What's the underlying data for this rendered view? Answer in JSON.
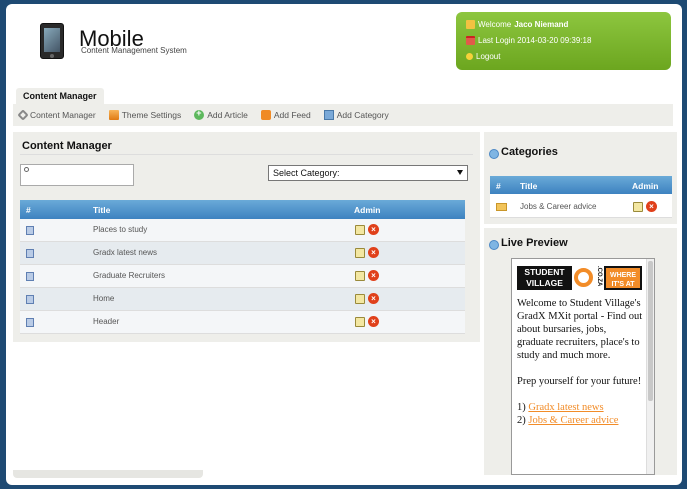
{
  "header": {
    "app_title": "Mobile",
    "app_subtitle": "Content Management System",
    "welcome_label": "Welcome",
    "user_name": "Jaco Niemand",
    "last_login": "Last Login 2014-03-20 09:39:18",
    "logout": "Logout"
  },
  "tabs": [
    {
      "label": "Content Manager"
    }
  ],
  "toolbar": {
    "items": [
      {
        "label": "Content Manager",
        "icon": "wrench-icon"
      },
      {
        "label": "Theme Settings",
        "icon": "theme-icon"
      },
      {
        "label": "Add Article",
        "icon": "add-icon"
      },
      {
        "label": "Add Feed",
        "icon": "rss-icon"
      },
      {
        "label": "Add Category",
        "icon": "category-icon"
      }
    ]
  },
  "content_manager": {
    "title": "Content Manager",
    "search_placeholder": "",
    "category_select": "Select Category:",
    "columns": {
      "num": "#",
      "title": "Title",
      "admin": "Admin"
    },
    "rows": [
      {
        "title": "Places to study"
      },
      {
        "title": "Gradx latest news"
      },
      {
        "title": "Graduate Recruiters"
      },
      {
        "title": "Home"
      },
      {
        "title": "Header"
      }
    ]
  },
  "categories": {
    "title": "Categories",
    "columns": {
      "num": "#",
      "title": "Title",
      "admin": "Admin"
    },
    "rows": [
      {
        "title": "Jobs & Career advice"
      }
    ]
  },
  "live_preview": {
    "title": "Live Preview",
    "logo": {
      "student": "STUDENT",
      "village": "VILLAGE",
      "co": ".CO.ZA",
      "where": "WHERE",
      "its_at": "IT'S AT"
    },
    "intro": "Welcome to Student Village's GradX MXit portal - Find out about bursaries, jobs, graduate recruiters, place's to study and much more.",
    "prep": "Prep yourself for your future!",
    "links": [
      {
        "num": "1)",
        "label": "Gradx latest news"
      },
      {
        "num": "2)",
        "label": "Jobs & Career advice"
      }
    ]
  },
  "colors": {
    "accent_green": "#8dc63f",
    "table_header": "#3d82c0",
    "background": "#1e4a73",
    "brand_orange": "#f28c28"
  }
}
